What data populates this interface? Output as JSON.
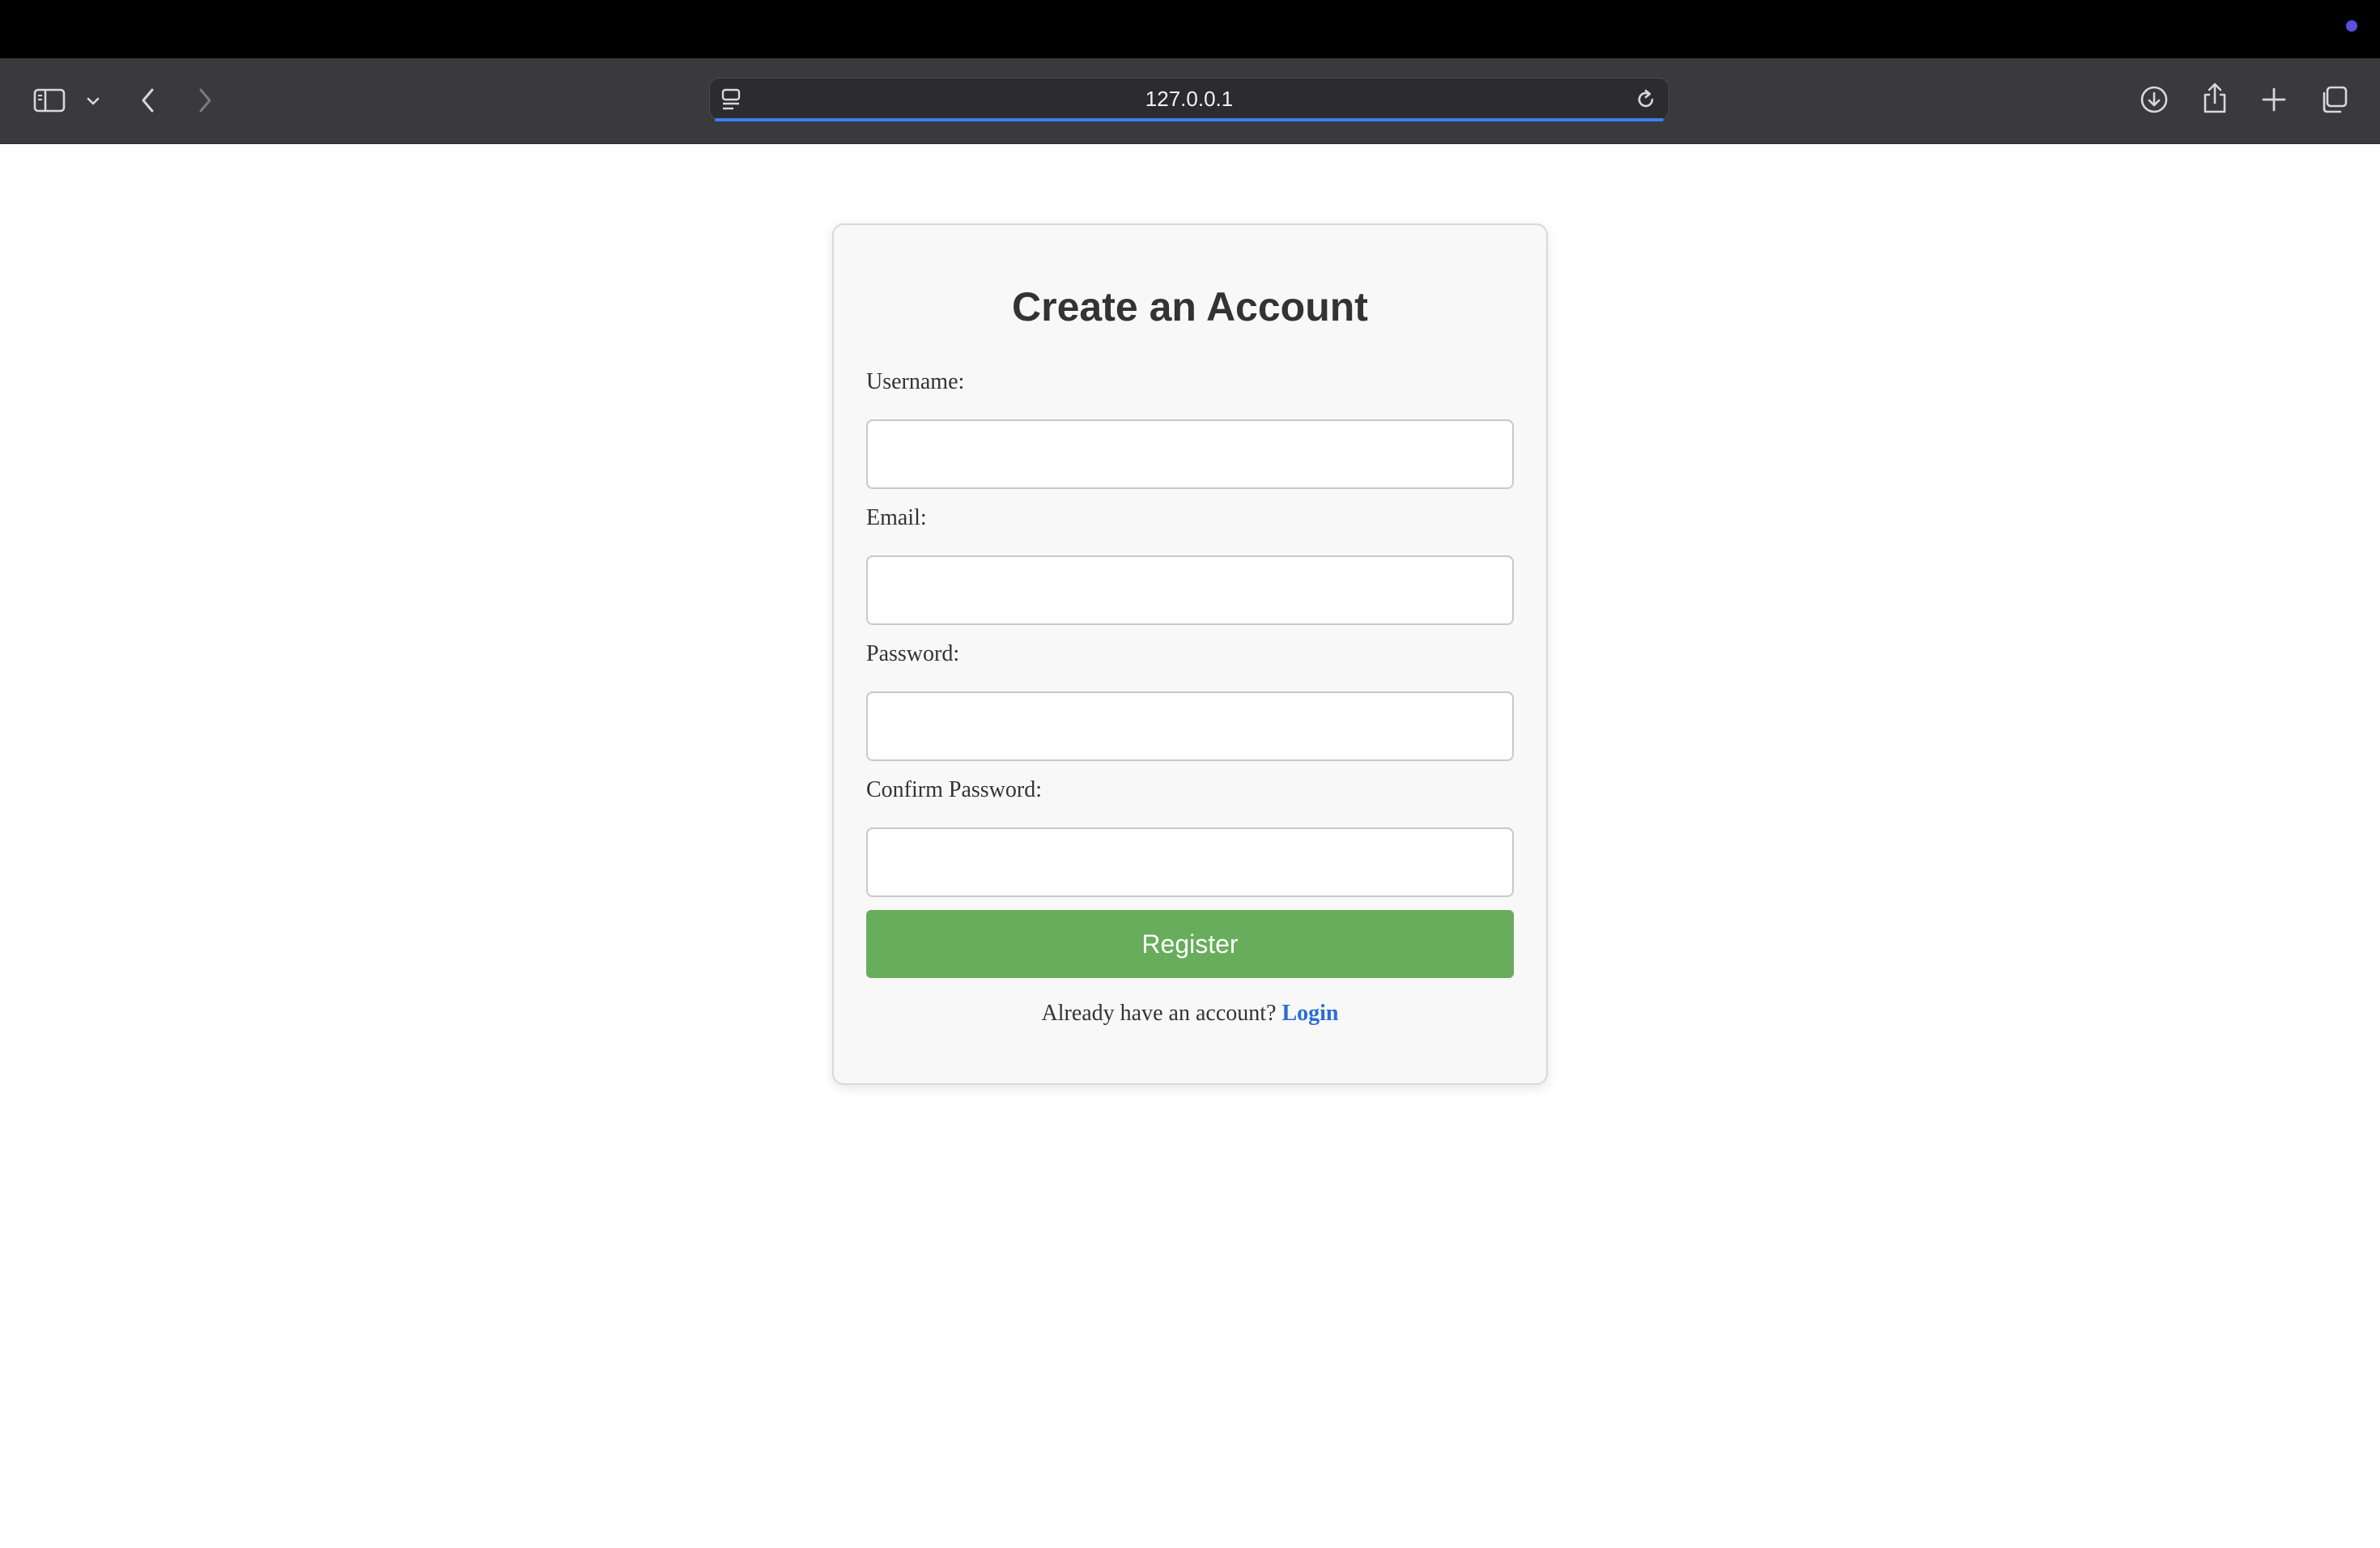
{
  "browser": {
    "url": "127.0.0.1",
    "icons": {
      "sidebar": "sidebar-icon",
      "sidebar_menu": "chevron-down-icon",
      "back": "chevron-left-icon",
      "forward": "chevron-right-icon",
      "page_menu": "page-menu-icon",
      "reload": "reload-icon",
      "downloads": "download-icon",
      "share": "share-icon",
      "new_tab": "plus-icon",
      "tab_overview": "tabs-icon"
    },
    "accent_color": "#3b7ff5"
  },
  "form": {
    "title": "Create an Account",
    "fields": {
      "username": {
        "label": "Username:",
        "value": ""
      },
      "email": {
        "label": "Email:",
        "value": ""
      },
      "password": {
        "label": "Password:",
        "value": ""
      },
      "confirm_password": {
        "label": "Confirm Password:",
        "value": ""
      }
    },
    "submit_label": "Register",
    "submit_color": "#67ad5b",
    "login_prompt": "Already have an account?",
    "login_link": "Login",
    "link_color": "#2a6ed4"
  }
}
